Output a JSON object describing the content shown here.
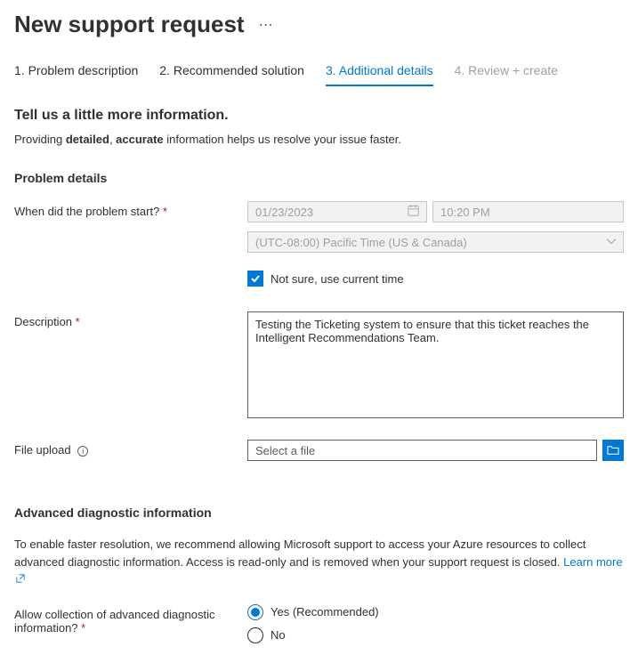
{
  "header": {
    "title": "New support request"
  },
  "tabs": [
    {
      "label": "1. Problem description"
    },
    {
      "label": "2. Recommended solution"
    },
    {
      "label": "3. Additional details"
    },
    {
      "label": "4. Review + create"
    }
  ],
  "intro": {
    "heading": "Tell us a little more information.",
    "sub_prefix": "Providing ",
    "sub_bold1": "detailed",
    "sub_sep": ", ",
    "sub_bold2": "accurate",
    "sub_suffix": " information helps us resolve your issue faster."
  },
  "problem": {
    "heading": "Problem details",
    "when_label": "When did the problem start? ",
    "date_value": "01/23/2023",
    "time_value": "10:20 PM",
    "tz_value": "(UTC-08:00) Pacific Time (US & Canada)",
    "notsure_label": "Not sure, use current time",
    "desc_label": "Description ",
    "desc_value": "Testing the Ticketing system to ensure that this ticket reaches the Intelligent Recommendations Team.",
    "file_label": "File upload",
    "file_placeholder": "Select a file"
  },
  "advanced": {
    "heading": "Advanced diagnostic information",
    "desc": "To enable faster resolution, we recommend allowing Microsoft support to access your Azure resources to collect advanced diagnostic information. Access is read-only and is removed when your support request is closed. ",
    "learn_more": "Learn more",
    "allow_label": "Allow collection of advanced diagnostic information? ",
    "yes_label": "Yes (Recommended)",
    "no_label": "No"
  }
}
